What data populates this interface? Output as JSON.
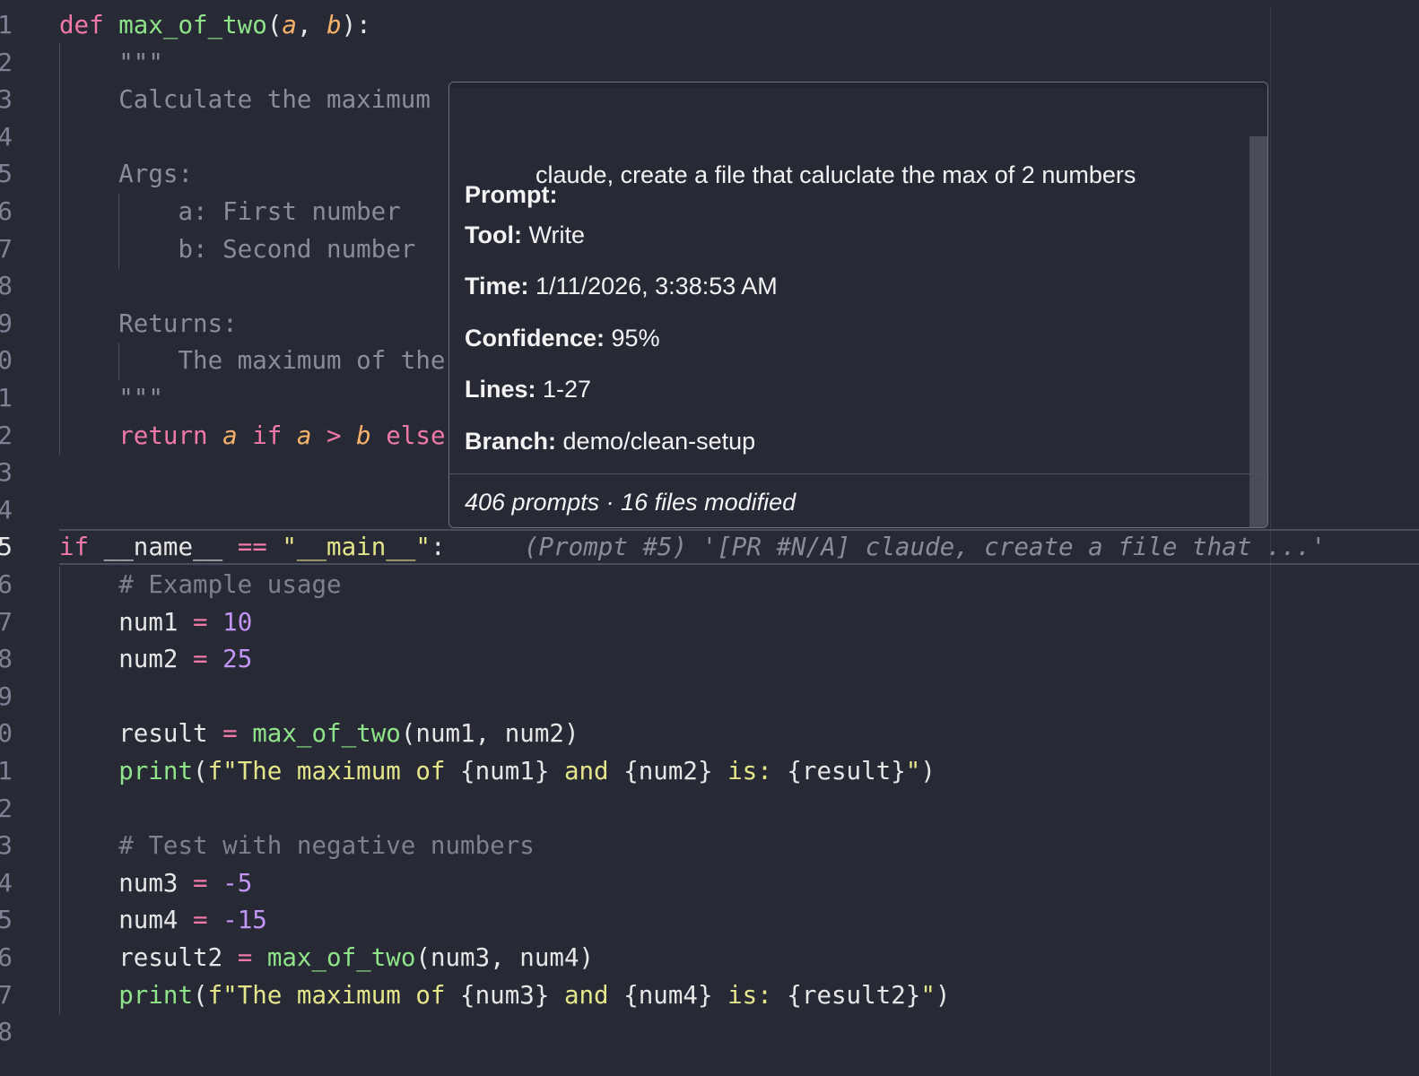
{
  "editor": {
    "line_numbers": [
      "1",
      "2",
      "3",
      "4",
      "5",
      "6",
      "7",
      "8",
      "9",
      "0",
      "1",
      "2",
      "3",
      "4",
      "5",
      "6",
      "7",
      "8",
      "9",
      "0",
      "1",
      "2",
      "3",
      "4",
      "5",
      "6",
      "7",
      "8"
    ],
    "lines": {
      "l1": [
        [
          "kw",
          "def "
        ],
        [
          "fn",
          "max_of_two"
        ],
        [
          "pt",
          "("
        ],
        [
          "par",
          "a"
        ],
        [
          "pt",
          ", "
        ],
        [
          "par",
          "b"
        ],
        [
          "pt",
          "):"
        ]
      ],
      "l2": [
        [
          "doc",
          "    \"\"\""
        ]
      ],
      "l3": [
        [
          "doc",
          "    Calculate the maximum"
        ]
      ],
      "l4": [],
      "l5": [
        [
          "doc",
          "    Args:"
        ]
      ],
      "l6": [
        [
          "doc",
          "        a: First number"
        ]
      ],
      "l7": [
        [
          "doc",
          "        b: Second number"
        ]
      ],
      "l8": [],
      "l9": [
        [
          "doc",
          "    Returns:"
        ]
      ],
      "l10": [
        [
          "doc",
          "        The maximum of the"
        ]
      ],
      "l11": [
        [
          "doc",
          "    \"\"\""
        ]
      ],
      "l12": [
        [
          "kw",
          "    return "
        ],
        [
          "par",
          "a"
        ],
        [
          "kw",
          " if "
        ],
        [
          "par",
          "a"
        ],
        [
          "op",
          " > "
        ],
        [
          "par",
          "b"
        ],
        [
          "kw",
          " else"
        ]
      ],
      "l13": [],
      "l14": [],
      "l15": [
        [
          "kw",
          "if "
        ],
        [
          "pt",
          "__name__ "
        ],
        [
          "op",
          "=="
        ],
        [
          "pt",
          " "
        ],
        [
          "str",
          "\"__main__\""
        ],
        [
          "pt",
          ":"
        ]
      ],
      "l16": [
        [
          "cm",
          "    # Example usage"
        ]
      ],
      "l17": [
        [
          "pt",
          "    num1 "
        ],
        [
          "op",
          "="
        ],
        [
          "pt",
          " "
        ],
        [
          "num",
          "10"
        ]
      ],
      "l18": [
        [
          "pt",
          "    num2 "
        ],
        [
          "op",
          "="
        ],
        [
          "pt",
          " "
        ],
        [
          "num",
          "25"
        ]
      ],
      "l19": [],
      "l20": [
        [
          "pt",
          "    result "
        ],
        [
          "op",
          "="
        ],
        [
          "pt",
          " "
        ],
        [
          "fn",
          "max_of_two"
        ],
        [
          "pt",
          "(num1, num2)"
        ]
      ],
      "l21": [
        [
          "fn",
          "    print"
        ],
        [
          "pt",
          "("
        ],
        [
          "str",
          "f\"The maximum of "
        ],
        [
          "pt",
          "{num1}"
        ],
        [
          "str",
          " and "
        ],
        [
          "pt",
          "{num2}"
        ],
        [
          "str",
          " is: "
        ],
        [
          "pt",
          "{result}"
        ],
        [
          "str",
          "\""
        ],
        [
          "pt",
          ")"
        ]
      ],
      "l22": [],
      "l23": [
        [
          "cm",
          "    # Test with negative numbers"
        ]
      ],
      "l24": [
        [
          "pt",
          "    num3 "
        ],
        [
          "op",
          "="
        ],
        [
          "pt",
          " "
        ],
        [
          "num",
          "-5"
        ]
      ],
      "l25": [
        [
          "pt",
          "    num4 "
        ],
        [
          "op",
          "="
        ],
        [
          "pt",
          " "
        ],
        [
          "num",
          "-15"
        ]
      ],
      "l26": [
        [
          "pt",
          "    result2 "
        ],
        [
          "op",
          "="
        ],
        [
          "pt",
          " "
        ],
        [
          "fn",
          "max_of_two"
        ],
        [
          "pt",
          "(num3, num4)"
        ]
      ],
      "l27": [
        [
          "fn",
          "    print"
        ],
        [
          "pt",
          "("
        ],
        [
          "str",
          "f\"The maximum of "
        ],
        [
          "pt",
          "{num3}"
        ],
        [
          "str",
          " and "
        ],
        [
          "pt",
          "{num4}"
        ],
        [
          "str",
          " is: "
        ],
        [
          "pt",
          "{result2}"
        ],
        [
          "str",
          "\""
        ],
        [
          "pt",
          ")"
        ]
      ],
      "l28": []
    },
    "ghost_text": "(Prompt #5) '[PR #N/A] claude, create a file that ...'"
  },
  "popover": {
    "prompt_label": "Prompt:",
    "prompt_text": "claude, create a file that caluclate the max of 2 numbers",
    "tool_label": "Tool:",
    "tool_value": "Write",
    "time_label": "Time:",
    "time_value": "1/11/2026, 3:38:53 AM",
    "confidence_label": "Confidence:",
    "confidence_value": "95%",
    "lines_label": "Lines:",
    "lines_value": "1-27",
    "branch_label": "Branch:",
    "branch_value": "demo/clean-setup",
    "footer": "406 prompts · 16 files modified"
  }
}
